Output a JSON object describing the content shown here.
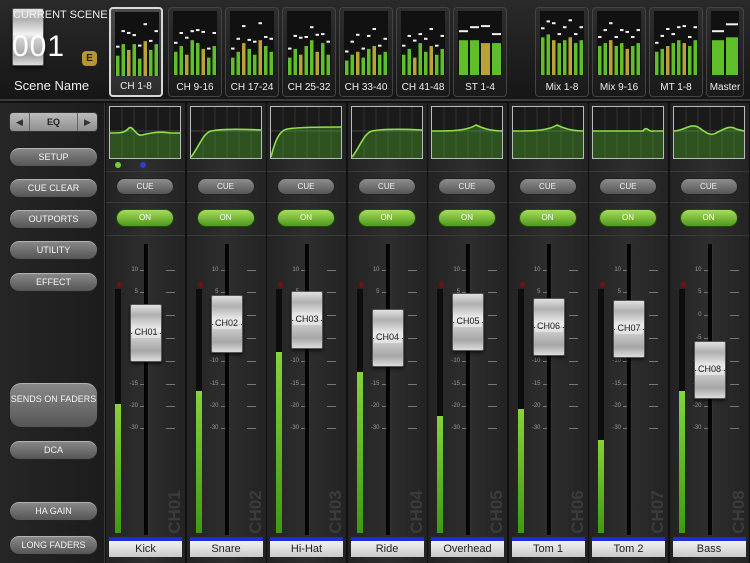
{
  "scene": {
    "caption": "CURRENT SCENE",
    "number": "001",
    "badge": "E",
    "name": "Scene Name"
  },
  "layer_tiles": [
    {
      "label": "CH 1-8",
      "selected": true,
      "levels": [
        0.35,
        0.55,
        0.45,
        0.55,
        0.3,
        0.6,
        0.45,
        0.55
      ]
    },
    {
      "label": "CH 9-16",
      "selected": false,
      "levels": [
        0.4,
        0.5,
        0.35,
        0.6,
        0.55,
        0.45,
        0.3,
        0.5
      ]
    },
    {
      "label": "CH 17-24",
      "selected": false,
      "levels": [
        0.3,
        0.4,
        0.55,
        0.45,
        0.35,
        0.6,
        0.5,
        0.4
      ]
    },
    {
      "label": "CH 25-32",
      "selected": false,
      "levels": [
        0.3,
        0.45,
        0.35,
        0.5,
        0.6,
        0.4,
        0.55,
        0.35
      ]
    },
    {
      "label": "CH 33-40",
      "selected": false,
      "levels": [
        0.25,
        0.35,
        0.4,
        0.3,
        0.45,
        0.5,
        0.35,
        0.4
      ]
    },
    {
      "label": "CH 41-48",
      "selected": false,
      "levels": [
        0.35,
        0.45,
        0.3,
        0.55,
        0.4,
        0.5,
        0.35,
        0.45
      ]
    },
    {
      "label": "ST 1-4",
      "selected": false,
      "levels": [
        0.6,
        0.6,
        0.55,
        0.55
      ]
    },
    {
      "label": "Mix 1-8",
      "selected": false,
      "levels": [
        0.65,
        0.7,
        0.6,
        0.55,
        0.6,
        0.65,
        0.55,
        0.6
      ]
    },
    {
      "label": "Mix 9-16",
      "selected": false,
      "levels": [
        0.5,
        0.55,
        0.6,
        0.5,
        0.55,
        0.45,
        0.5,
        0.55
      ]
    },
    {
      "label": "MT 1-8",
      "selected": false,
      "levels": [
        0.4,
        0.45,
        0.5,
        0.55,
        0.6,
        0.55,
        0.5,
        0.6
      ]
    },
    {
      "label": "Master",
      "selected": false,
      "levels": [
        0.6,
        0.65
      ]
    }
  ],
  "left_panel": {
    "eq_selector": {
      "label": "EQ",
      "prev_icon": "triangle-left-icon",
      "next_icon": "triangle-right-icon"
    },
    "setup": "SETUP",
    "cue_clear": "CUE CLEAR",
    "outports": "OUTPORTS",
    "utility": "UTILITY",
    "effect": "EFFECT",
    "sends_on_faders": "SENDS ON FADERS",
    "dca": "DCA",
    "ha_gain": "HA GAIN",
    "long_faders": "LONG FADERS"
  },
  "scale_ticks": [
    "10",
    "5",
    "0",
    "-5",
    "-10",
    "-15",
    "-20",
    "-30"
  ],
  "colors": {
    "on_green": "#6cbf2d",
    "meter_green": "#86d33a",
    "name_bar_blue": "#1c2ed6",
    "scene_badge": "#b8962e"
  },
  "channels": [
    {
      "id": "CH01",
      "name": "Kick",
      "cue_label": "CUE",
      "on_label": "ON",
      "meter_level": 0.53,
      "fader_db": -4,
      "eq_curve": "dip"
    },
    {
      "id": "CH02",
      "name": "Snare",
      "cue_label": "CUE",
      "on_label": "ON",
      "meter_level": 0.58,
      "fader_db": -2,
      "eq_curve": "highpass"
    },
    {
      "id": "CH03",
      "name": "Hi-Hat",
      "cue_label": "CUE",
      "on_label": "ON",
      "meter_level": 0.74,
      "fader_db": -1,
      "eq_curve": "highpass-steep"
    },
    {
      "id": "CH04",
      "name": "Ride",
      "cue_label": "CUE",
      "on_label": "ON",
      "meter_level": 0.66,
      "fader_db": -5,
      "eq_curve": "highpass"
    },
    {
      "id": "CH05",
      "name": "Overhead",
      "cue_label": "CUE",
      "on_label": "ON",
      "meter_level": 0.48,
      "fader_db": -1.5,
      "eq_curve": "flat-bump"
    },
    {
      "id": "CH06",
      "name": "Tom 1",
      "cue_label": "CUE",
      "on_label": "ON",
      "meter_level": 0.51,
      "fader_db": -2.5,
      "eq_curve": "flat-bump"
    },
    {
      "id": "CH07",
      "name": "Tom 2",
      "cue_label": "CUE",
      "on_label": "ON",
      "meter_level": 0.38,
      "fader_db": -3,
      "eq_curve": "flat-notch"
    },
    {
      "id": "CH08",
      "name": "Bass",
      "cue_label": "CUE",
      "on_label": "ON",
      "meter_level": 0.58,
      "fader_db": -12,
      "eq_curve": "wave"
    }
  ]
}
